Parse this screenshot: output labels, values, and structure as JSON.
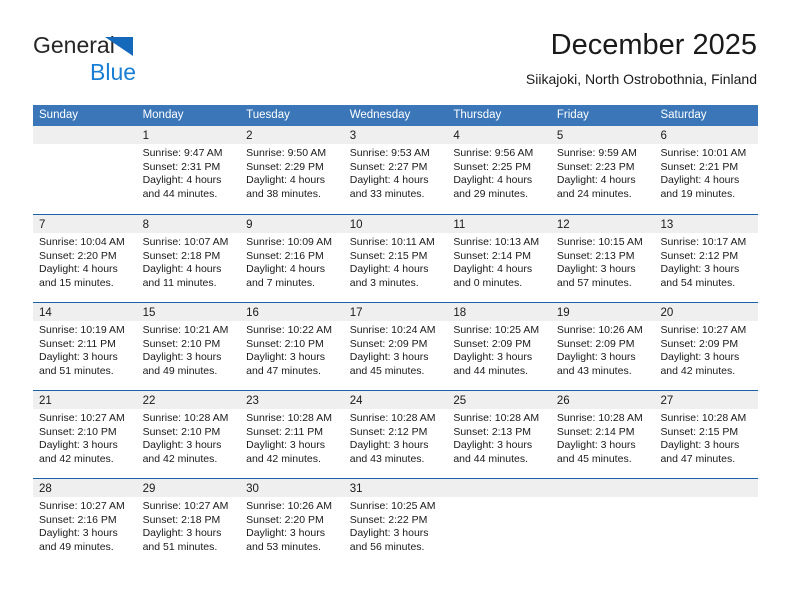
{
  "brand": {
    "line1": "General",
    "line2": "Blue",
    "triangle_color": "#1469bb",
    "blue_text_color": "#1a7fd4"
  },
  "header": {
    "title": "December 2025",
    "subtitle": "Siikajoki, North Ostrobothnia, Finland"
  },
  "theme": {
    "header_bg": "#3a76b8",
    "week_rule": "#1b62ab",
    "daynum_band": "#efefef"
  },
  "calendar": {
    "weekday_headers": [
      "Sunday",
      "Monday",
      "Tuesday",
      "Wednesday",
      "Thursday",
      "Friday",
      "Saturday"
    ],
    "weeks": [
      [
        {
          "day": "",
          "sunrise": "",
          "sunset": "",
          "daylight1": "",
          "daylight2": ""
        },
        {
          "day": "1",
          "sunrise": "Sunrise: 9:47 AM",
          "sunset": "Sunset: 2:31 PM",
          "daylight1": "Daylight: 4 hours",
          "daylight2": "and 44 minutes."
        },
        {
          "day": "2",
          "sunrise": "Sunrise: 9:50 AM",
          "sunset": "Sunset: 2:29 PM",
          "daylight1": "Daylight: 4 hours",
          "daylight2": "and 38 minutes."
        },
        {
          "day": "3",
          "sunrise": "Sunrise: 9:53 AM",
          "sunset": "Sunset: 2:27 PM",
          "daylight1": "Daylight: 4 hours",
          "daylight2": "and 33 minutes."
        },
        {
          "day": "4",
          "sunrise": "Sunrise: 9:56 AM",
          "sunset": "Sunset: 2:25 PM",
          "daylight1": "Daylight: 4 hours",
          "daylight2": "and 29 minutes."
        },
        {
          "day": "5",
          "sunrise": "Sunrise: 9:59 AM",
          "sunset": "Sunset: 2:23 PM",
          "daylight1": "Daylight: 4 hours",
          "daylight2": "and 24 minutes."
        },
        {
          "day": "6",
          "sunrise": "Sunrise: 10:01 AM",
          "sunset": "Sunset: 2:21 PM",
          "daylight1": "Daylight: 4 hours",
          "daylight2": "and 19 minutes."
        }
      ],
      [
        {
          "day": "7",
          "sunrise": "Sunrise: 10:04 AM",
          "sunset": "Sunset: 2:20 PM",
          "daylight1": "Daylight: 4 hours",
          "daylight2": "and 15 minutes."
        },
        {
          "day": "8",
          "sunrise": "Sunrise: 10:07 AM",
          "sunset": "Sunset: 2:18 PM",
          "daylight1": "Daylight: 4 hours",
          "daylight2": "and 11 minutes."
        },
        {
          "day": "9",
          "sunrise": "Sunrise: 10:09 AM",
          "sunset": "Sunset: 2:16 PM",
          "daylight1": "Daylight: 4 hours",
          "daylight2": "and 7 minutes."
        },
        {
          "day": "10",
          "sunrise": "Sunrise: 10:11 AM",
          "sunset": "Sunset: 2:15 PM",
          "daylight1": "Daylight: 4 hours",
          "daylight2": "and 3 minutes."
        },
        {
          "day": "11",
          "sunrise": "Sunrise: 10:13 AM",
          "sunset": "Sunset: 2:14 PM",
          "daylight1": "Daylight: 4 hours",
          "daylight2": "and 0 minutes."
        },
        {
          "day": "12",
          "sunrise": "Sunrise: 10:15 AM",
          "sunset": "Sunset: 2:13 PM",
          "daylight1": "Daylight: 3 hours",
          "daylight2": "and 57 minutes."
        },
        {
          "day": "13",
          "sunrise": "Sunrise: 10:17 AM",
          "sunset": "Sunset: 2:12 PM",
          "daylight1": "Daylight: 3 hours",
          "daylight2": "and 54 minutes."
        }
      ],
      [
        {
          "day": "14",
          "sunrise": "Sunrise: 10:19 AM",
          "sunset": "Sunset: 2:11 PM",
          "daylight1": "Daylight: 3 hours",
          "daylight2": "and 51 minutes."
        },
        {
          "day": "15",
          "sunrise": "Sunrise: 10:21 AM",
          "sunset": "Sunset: 2:10 PM",
          "daylight1": "Daylight: 3 hours",
          "daylight2": "and 49 minutes."
        },
        {
          "day": "16",
          "sunrise": "Sunrise: 10:22 AM",
          "sunset": "Sunset: 2:10 PM",
          "daylight1": "Daylight: 3 hours",
          "daylight2": "and 47 minutes."
        },
        {
          "day": "17",
          "sunrise": "Sunrise: 10:24 AM",
          "sunset": "Sunset: 2:09 PM",
          "daylight1": "Daylight: 3 hours",
          "daylight2": "and 45 minutes."
        },
        {
          "day": "18",
          "sunrise": "Sunrise: 10:25 AM",
          "sunset": "Sunset: 2:09 PM",
          "daylight1": "Daylight: 3 hours",
          "daylight2": "and 44 minutes."
        },
        {
          "day": "19",
          "sunrise": "Sunrise: 10:26 AM",
          "sunset": "Sunset: 2:09 PM",
          "daylight1": "Daylight: 3 hours",
          "daylight2": "and 43 minutes."
        },
        {
          "day": "20",
          "sunrise": "Sunrise: 10:27 AM",
          "sunset": "Sunset: 2:09 PM",
          "daylight1": "Daylight: 3 hours",
          "daylight2": "and 42 minutes."
        }
      ],
      [
        {
          "day": "21",
          "sunrise": "Sunrise: 10:27 AM",
          "sunset": "Sunset: 2:10 PM",
          "daylight1": "Daylight: 3 hours",
          "daylight2": "and 42 minutes."
        },
        {
          "day": "22",
          "sunrise": "Sunrise: 10:28 AM",
          "sunset": "Sunset: 2:10 PM",
          "daylight1": "Daylight: 3 hours",
          "daylight2": "and 42 minutes."
        },
        {
          "day": "23",
          "sunrise": "Sunrise: 10:28 AM",
          "sunset": "Sunset: 2:11 PM",
          "daylight1": "Daylight: 3 hours",
          "daylight2": "and 42 minutes."
        },
        {
          "day": "24",
          "sunrise": "Sunrise: 10:28 AM",
          "sunset": "Sunset: 2:12 PM",
          "daylight1": "Daylight: 3 hours",
          "daylight2": "and 43 minutes."
        },
        {
          "day": "25",
          "sunrise": "Sunrise: 10:28 AM",
          "sunset": "Sunset: 2:13 PM",
          "daylight1": "Daylight: 3 hours",
          "daylight2": "and 44 minutes."
        },
        {
          "day": "26",
          "sunrise": "Sunrise: 10:28 AM",
          "sunset": "Sunset: 2:14 PM",
          "daylight1": "Daylight: 3 hours",
          "daylight2": "and 45 minutes."
        },
        {
          "day": "27",
          "sunrise": "Sunrise: 10:28 AM",
          "sunset": "Sunset: 2:15 PM",
          "daylight1": "Daylight: 3 hours",
          "daylight2": "and 47 minutes."
        }
      ],
      [
        {
          "day": "28",
          "sunrise": "Sunrise: 10:27 AM",
          "sunset": "Sunset: 2:16 PM",
          "daylight1": "Daylight: 3 hours",
          "daylight2": "and 49 minutes."
        },
        {
          "day": "29",
          "sunrise": "Sunrise: 10:27 AM",
          "sunset": "Sunset: 2:18 PM",
          "daylight1": "Daylight: 3 hours",
          "daylight2": "and 51 minutes."
        },
        {
          "day": "30",
          "sunrise": "Sunrise: 10:26 AM",
          "sunset": "Sunset: 2:20 PM",
          "daylight1": "Daylight: 3 hours",
          "daylight2": "and 53 minutes."
        },
        {
          "day": "31",
          "sunrise": "Sunrise: 10:25 AM",
          "sunset": "Sunset: 2:22 PM",
          "daylight1": "Daylight: 3 hours",
          "daylight2": "and 56 minutes."
        },
        {
          "day": "",
          "sunrise": "",
          "sunset": "",
          "daylight1": "",
          "daylight2": ""
        },
        {
          "day": "",
          "sunrise": "",
          "sunset": "",
          "daylight1": "",
          "daylight2": ""
        },
        {
          "day": "",
          "sunrise": "",
          "sunset": "",
          "daylight1": "",
          "daylight2": ""
        }
      ]
    ]
  }
}
